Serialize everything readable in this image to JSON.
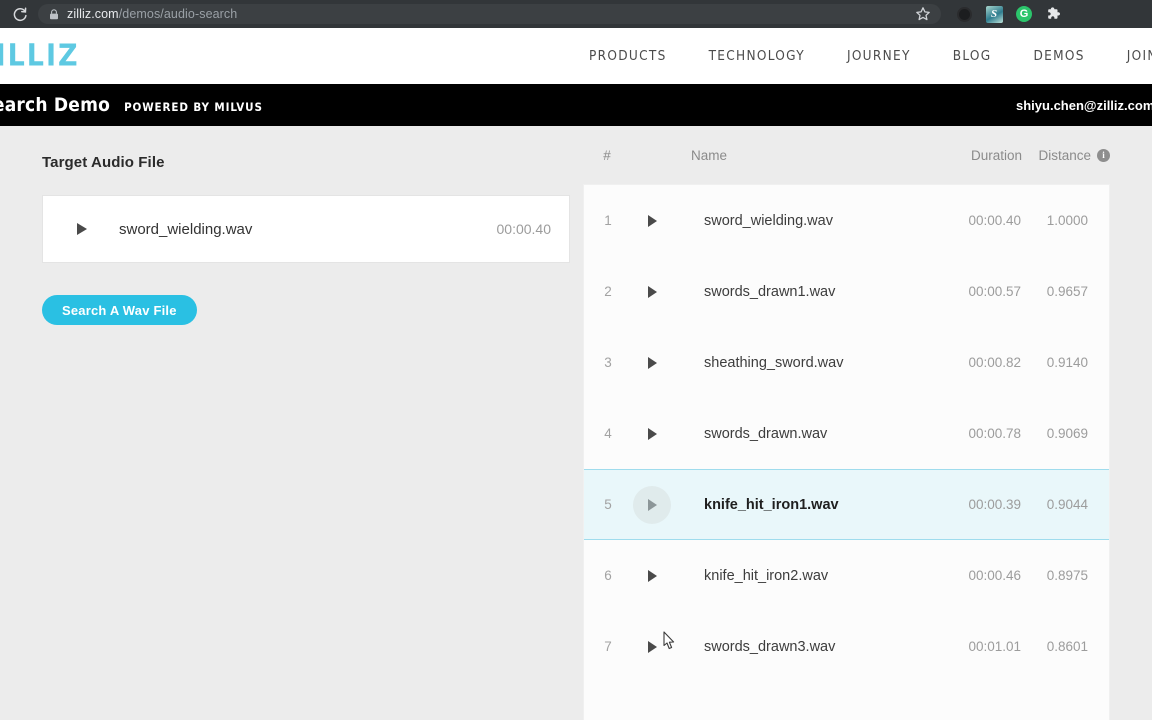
{
  "browser": {
    "reload_icon": "reload-icon",
    "lock_icon": "lock-icon",
    "url_host": "zilliz.com",
    "url_path": "/demos/audio-search",
    "star_icon": "star-icon",
    "extensions": [
      {
        "name": "circle-extension-icon",
        "label": ""
      },
      {
        "name": "s-extension-icon",
        "label": "S"
      },
      {
        "name": "g-extension-icon",
        "label": "G"
      },
      {
        "name": "puzzle-extension-icon",
        "label": ""
      }
    ]
  },
  "site_nav": {
    "logo_text": "ZILLIZ",
    "links": [
      {
        "label": "PRODUCTS"
      },
      {
        "label": "TECHNOLOGY"
      },
      {
        "label": "JOURNEY"
      },
      {
        "label": "BLOG"
      },
      {
        "label": "DEMOS"
      },
      {
        "label": "JOIN"
      }
    ]
  },
  "demo_bar": {
    "title": "Audio Search Demo",
    "powered_by": "POWERED BY MILVUS",
    "user_email": "shiyu.chen@zilliz.com"
  },
  "left_panel": {
    "section_title": "Target Audio File",
    "target": {
      "play_icon": "play-icon",
      "filename": "sword_wielding.wav",
      "duration": "00:00.40"
    },
    "search_button": "Search A Wav File"
  },
  "results": {
    "columns": {
      "index": "#",
      "name": "Name",
      "duration": "Duration",
      "distance": "Distance",
      "info_icon": "i"
    },
    "rows": [
      {
        "index": "1",
        "name": "sword_wielding.wav",
        "duration": "00:00.40",
        "distance": "1.0000",
        "active": false
      },
      {
        "index": "2",
        "name": "swords_drawn1.wav",
        "duration": "00:00.57",
        "distance": "0.9657",
        "active": false
      },
      {
        "index": "3",
        "name": "sheathing_sword.wav",
        "duration": "00:00.82",
        "distance": "0.9140",
        "active": false
      },
      {
        "index": "4",
        "name": "swords_drawn.wav",
        "duration": "00:00.78",
        "distance": "0.9069",
        "active": false
      },
      {
        "index": "5",
        "name": "knife_hit_iron1.wav",
        "duration": "00:00.39",
        "distance": "0.9044",
        "active": true
      },
      {
        "index": "6",
        "name": "knife_hit_iron2.wav",
        "duration": "00:00.46",
        "distance": "0.8975",
        "active": false
      },
      {
        "index": "7",
        "name": "swords_drawn3.wav",
        "duration": "00:01.01",
        "distance": "0.8601",
        "active": false
      }
    ]
  },
  "colors": {
    "accent": "#2ac0e3",
    "logo": "#5ec9e2",
    "page_bg": "#ececec",
    "row_active_bg": "#e9f7fa",
    "row_active_border": "#9fdced"
  }
}
